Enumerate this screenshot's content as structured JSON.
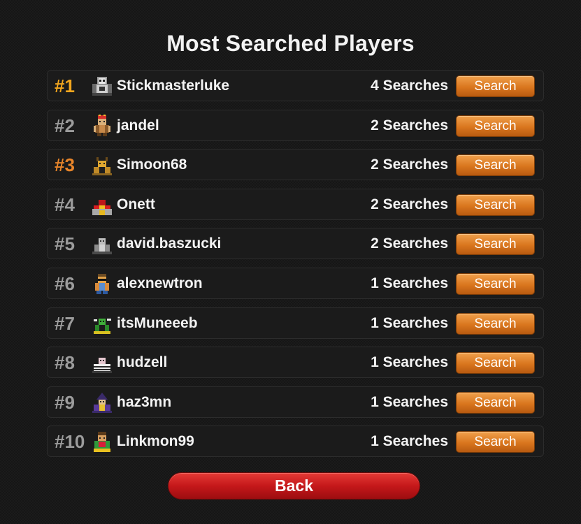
{
  "page": {
    "title": "Most Searched Players",
    "back_label": "Back",
    "search_label": "Search"
  },
  "players": [
    {
      "rank": "#1",
      "name": "Stickmasterluke",
      "searches": "4 Searches",
      "avatar": "avatar-stickmasterluke-icon"
    },
    {
      "rank": "#2",
      "name": "jandel",
      "searches": "2 Searches",
      "avatar": "avatar-jandel-icon"
    },
    {
      "rank": "#3",
      "name": "Simoon68",
      "searches": "2 Searches",
      "avatar": "avatar-simoon68-icon"
    },
    {
      "rank": "#4",
      "name": "Onett",
      "searches": "2 Searches",
      "avatar": "avatar-onett-icon"
    },
    {
      "rank": "#5",
      "name": "david.baszucki",
      "searches": "2 Searches",
      "avatar": "avatar-david-baszucki-icon"
    },
    {
      "rank": "#6",
      "name": "alexnewtron",
      "searches": "1 Searches",
      "avatar": "avatar-alexnewtron-icon"
    },
    {
      "rank": "#7",
      "name": "itsMuneeeb",
      "searches": "1 Searches",
      "avatar": "avatar-itsmuneeeb-icon"
    },
    {
      "rank": "#8",
      "name": "hudzell",
      "searches": "1 Searches",
      "avatar": "avatar-hudzell-icon"
    },
    {
      "rank": "#9",
      "name": "haz3mn",
      "searches": "1 Searches",
      "avatar": "avatar-haz3mn-icon"
    },
    {
      "rank": "#10",
      "name": "Linkmon99",
      "searches": "1 Searches",
      "avatar": "avatar-linkmon99-icon"
    }
  ],
  "colors": {
    "rank_gold": "#f2a61e",
    "rank_bronze": "#e8852a",
    "rank_default": "#9c9c9c",
    "search_button": "#d9761e",
    "back_button": "#c5181a"
  }
}
